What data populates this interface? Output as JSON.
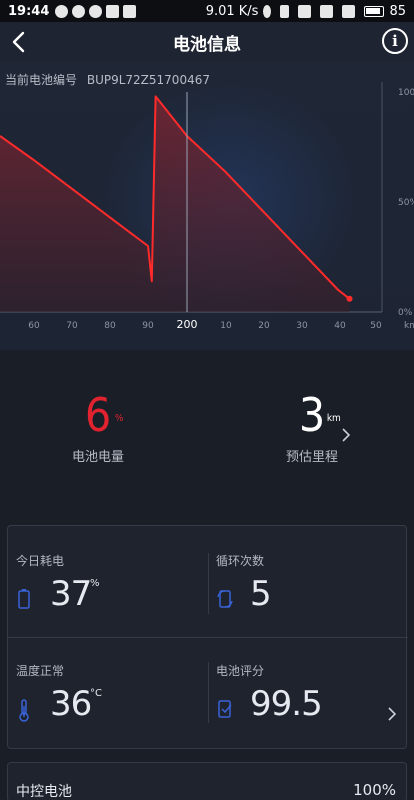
{
  "status_bar": {
    "time": "19:44",
    "net_speed": "9.01 K/s",
    "battery_level": "85"
  },
  "header": {
    "title": "电池信息",
    "back_icon": "chevron-left-icon",
    "info_icon": "info-circle-icon"
  },
  "battery_code": {
    "label": "当前电池编号",
    "value": "BUP9L72Z51700467"
  },
  "chart_data": {
    "type": "area",
    "title": "",
    "y_tick_labels": [
      "100%",
      "50%",
      "0%"
    ],
    "x_tick_labels": [
      "60",
      "70",
      "80",
      "90",
      "200",
      "10",
      "20",
      "30",
      "40",
      "50"
    ],
    "x_unit": "km",
    "x": [
      50,
      60,
      70,
      80,
      90,
      91,
      92,
      200,
      210,
      220,
      230,
      240,
      243
    ],
    "y": [
      80,
      69,
      56,
      43,
      30,
      14,
      98,
      80,
      64,
      46,
      28,
      10,
      6
    ],
    "ylim": [
      0,
      100
    ],
    "cursor_at": "200",
    "colors": {
      "line": "#ff2b2b",
      "fill_top": "#7a2532",
      "fill_bottom": "#3a1f2a"
    }
  },
  "stats": {
    "soc": {
      "value": "6",
      "unit": "%",
      "label": "电池电量"
    },
    "range": {
      "value": "3",
      "unit": "km",
      "label": "预估里程"
    }
  },
  "details": {
    "today_consumption": {
      "label": "今日耗电",
      "value": "37",
      "unit": "%",
      "icon": "battery-icon"
    },
    "cycle_count": {
      "label": "循环次数",
      "value": "5",
      "unit": "",
      "icon": "cycle-icon"
    },
    "temperature": {
      "label": "温度正常",
      "value": "36",
      "unit": "°C",
      "icon": "thermometer-icon"
    },
    "battery_score": {
      "label": "电池评分",
      "value": "99.5",
      "unit": "",
      "icon": "score-icon"
    }
  },
  "controller_battery": {
    "label": "中控电池",
    "value": "100%"
  },
  "colors": {
    "background": "#1a1e27",
    "accent_red": "#e0232e"
  }
}
